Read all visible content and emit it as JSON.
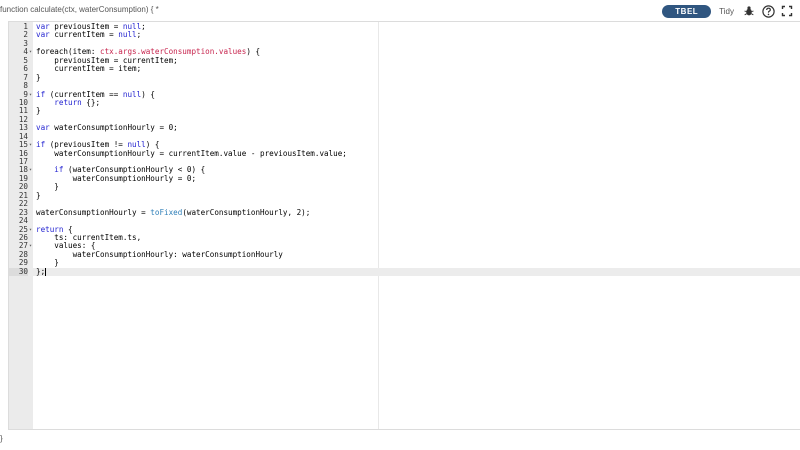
{
  "header": {
    "signature": "function calculate(ctx, waterConsumption) {  *",
    "language_badge": "TBEL",
    "tidy_label": "Tidy",
    "icons": [
      "bug-icon",
      "help-icon",
      "fullscreen-icon"
    ]
  },
  "colors": {
    "accent": "#305680",
    "keyword": "#1f1fd0",
    "property": "#c7254e",
    "function": "#2f7fb8"
  },
  "editor": {
    "active_line": 30,
    "lines": [
      {
        "n": "1",
        "fold": false,
        "segs": [
          {
            "t": "var",
            "c": "kw"
          },
          {
            "t": " previousItem = "
          },
          {
            "t": "null",
            "c": "kw"
          },
          {
            "t": ";"
          }
        ]
      },
      {
        "n": "2",
        "fold": false,
        "segs": [
          {
            "t": "var",
            "c": "kw"
          },
          {
            "t": " currentItem = "
          },
          {
            "t": "null",
            "c": "kw"
          },
          {
            "t": ";"
          }
        ]
      },
      {
        "n": "3",
        "fold": false,
        "segs": []
      },
      {
        "n": "4",
        "fold": true,
        "segs": [
          {
            "t": "foreach(item: "
          },
          {
            "t": "ctx.args.waterConsumption.values",
            "c": "prop"
          },
          {
            "t": ") {"
          }
        ]
      },
      {
        "n": "5",
        "fold": false,
        "segs": [
          {
            "t": "    previousItem = currentItem;"
          }
        ]
      },
      {
        "n": "6",
        "fold": false,
        "segs": [
          {
            "t": "    currentItem = item;"
          }
        ]
      },
      {
        "n": "7",
        "fold": false,
        "segs": [
          {
            "t": "}"
          }
        ]
      },
      {
        "n": "8",
        "fold": false,
        "segs": []
      },
      {
        "n": "9",
        "fold": true,
        "segs": [
          {
            "t": "if",
            "c": "kw"
          },
          {
            "t": " (currentItem == "
          },
          {
            "t": "null",
            "c": "kw"
          },
          {
            "t": ") {"
          }
        ]
      },
      {
        "n": "10",
        "fold": false,
        "segs": [
          {
            "t": "    "
          },
          {
            "t": "return",
            "c": "kw"
          },
          {
            "t": " {};"
          }
        ]
      },
      {
        "n": "11",
        "fold": false,
        "segs": [
          {
            "t": "}"
          }
        ]
      },
      {
        "n": "12",
        "fold": false,
        "segs": []
      },
      {
        "n": "13",
        "fold": false,
        "segs": [
          {
            "t": "var",
            "c": "kw"
          },
          {
            "t": " waterConsumptionHourly = 0;"
          }
        ]
      },
      {
        "n": "14",
        "fold": false,
        "segs": []
      },
      {
        "n": "15",
        "fold": true,
        "segs": [
          {
            "t": "if",
            "c": "kw"
          },
          {
            "t": " (previousItem != "
          },
          {
            "t": "null",
            "c": "kw"
          },
          {
            "t": ") {"
          }
        ]
      },
      {
        "n": "16",
        "fold": false,
        "segs": [
          {
            "t": "    waterConsumptionHourly = currentItem.value - previousItem.value;"
          }
        ]
      },
      {
        "n": "17",
        "fold": false,
        "segs": []
      },
      {
        "n": "18",
        "fold": true,
        "segs": [
          {
            "t": "    "
          },
          {
            "t": "if",
            "c": "kw"
          },
          {
            "t": " (waterConsumptionHourly < 0) {"
          }
        ]
      },
      {
        "n": "19",
        "fold": false,
        "segs": [
          {
            "t": "        waterConsumptionHourly = 0;"
          }
        ]
      },
      {
        "n": "20",
        "fold": false,
        "segs": [
          {
            "t": "    }"
          }
        ]
      },
      {
        "n": "21",
        "fold": false,
        "segs": [
          {
            "t": "}"
          }
        ]
      },
      {
        "n": "22",
        "fold": false,
        "segs": []
      },
      {
        "n": "23",
        "fold": false,
        "segs": [
          {
            "t": "waterConsumptionHourly = "
          },
          {
            "t": "toFixed",
            "c": "fn"
          },
          {
            "t": "(waterConsumptionHourly, 2);"
          }
        ]
      },
      {
        "n": "24",
        "fold": false,
        "segs": []
      },
      {
        "n": "25",
        "fold": true,
        "segs": [
          {
            "t": "return",
            "c": "kw"
          },
          {
            "t": " {"
          }
        ]
      },
      {
        "n": "26",
        "fold": false,
        "segs": [
          {
            "t": "    ts: currentItem.ts,"
          }
        ]
      },
      {
        "n": "27",
        "fold": true,
        "segs": [
          {
            "t": "    values: {"
          }
        ]
      },
      {
        "n": "28",
        "fold": false,
        "segs": [
          {
            "t": "        waterConsumptionHourly: waterConsumptionHourly"
          }
        ]
      },
      {
        "n": "29",
        "fold": false,
        "segs": [
          {
            "t": "    }"
          }
        ]
      },
      {
        "n": "30",
        "fold": false,
        "segs": [
          {
            "t": "};"
          }
        ]
      }
    ]
  },
  "footer": {
    "closing": "}"
  }
}
